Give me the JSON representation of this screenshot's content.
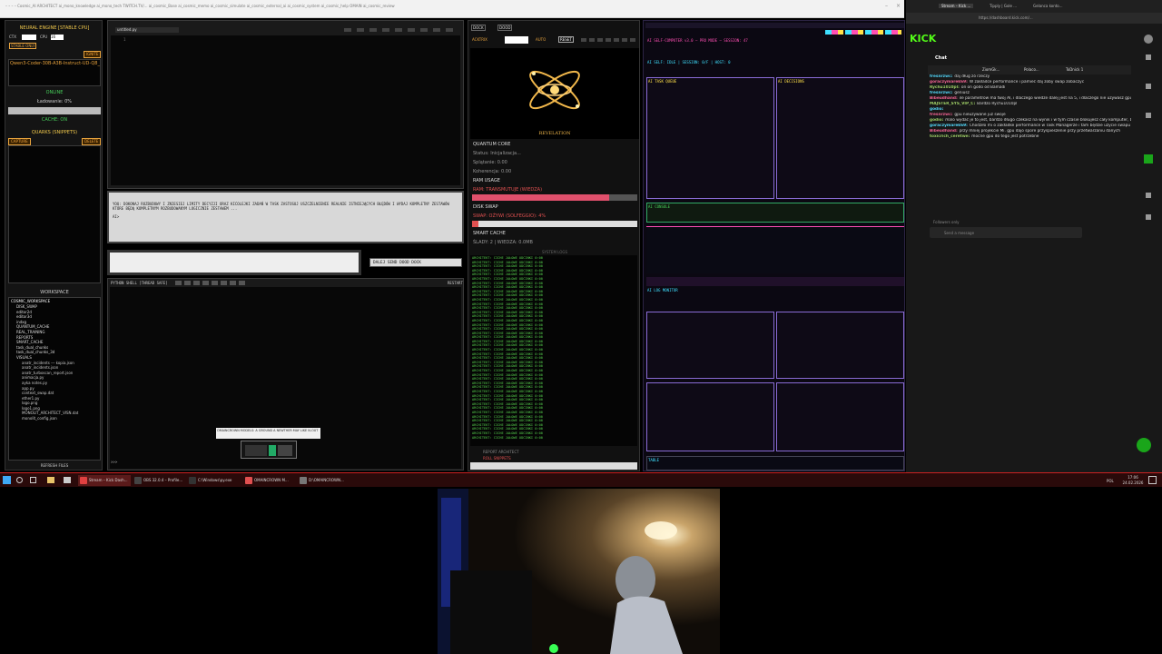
{
  "top_strip": {
    "tabs_text": "– – – – Cosmic_AI ARCHITECT   ai_mono_knowledge   ai_mono_tech   TWITCH.TV/...   ai_cosmic_Base   ai_cosmic_memo   ai_cosmic_simulate   ai_cosmic_external_ai   ai_cosmic_system   ai_cosmic_help   OMAIN   ai_cosmic_review"
  },
  "left_panel": {
    "title": "NEURAL ENGINE [STABLE CPU]",
    "ctx_label": "CTX",
    "cpu_label": "CPU",
    "cpu_value": "16",
    "stable_badge": "STABLE ONLY",
    "ignite_button": "IGNITE",
    "model_name": "Qwen3-Coder-30B-A3B-Instruct-UD-Q8_K_XL",
    "status_online": "ONLINE",
    "loading_text": "Ładowanie: 0%",
    "cache_status": "CACHE: ON",
    "quarks_title": "QUARKS (SNIPPETS)",
    "capture_button": "CAPTURE",
    "delete_button": "DELETE",
    "workspace_title": "WORKSPACE",
    "tree_root": "COSMIC_WORKSPACE",
    "tree_items": [
      "DISK_SWAP",
      "editor2d",
      "editor3d",
      "indxg",
      "QUANTUM_CACHE",
      "REAL_TRAINING",
      "REPORTS",
      "SMART_CACHE",
      "task_dual_chunks",
      "task_dual_chunks_3d",
      "VISUALS"
    ],
    "file_items": [
      "anatr_incidents --- kopia.json",
      "anatr_incidents.json",
      "anatr_turboscan_report.json",
      "animacja.py",
      "ayka notes.py",
      "app.py",
      "context_swap.dat",
      "ether1.py",
      "logo.png",
      "logo1.png",
      "MONOLIT_ARCHITECT_VISN.dat",
      "monolit_config.json"
    ],
    "refresh_button": "REFRESH FILES"
  },
  "editor": {
    "tab_name": "untitled.py",
    "line_number": "1",
    "prompt_text": "YOU: DOKONAJ ROZBUDOWY I ZNIESIEJ LIMITY DECYZJI ORAZ KICOLEJKI ZADAŃ W TASK ZASTOSUJ USZCZELNIENIE REALNIE ISTNIEJĄCYCH BŁĘDÓW I WYDAJ KOMPLETNY ZESTAWÓW KTÓRE BĘDĄ KOMPLETNYM ROZBUDOWANYM LOGICZNIE ZESTAWEM ...",
    "prompt_line2": "AI>",
    "send_button": "DALEJ SEND DOOD DOCK"
  },
  "shell": {
    "title": "PYTHON SHELL [THREAD SAFE]",
    "restart_button": "RESTART",
    "prompt": ">>>",
    "popup_text": "OMAINCROWN MODELS: A GROUND A NEWTHER MAY LIKE N-OUT"
  },
  "quantum": {
    "tabs": [
      "DOCK",
      "DOOD"
    ],
    "active_label": "ACKTRIX",
    "auto_label": "AUTO",
    "reset_button": "RESET",
    "revelation_label": "REVELATION",
    "quantum_core_title": "QUANTUM CORE",
    "status_text": "Status: Inicjalizacja...",
    "splatanie": "Splątanie: 0.00",
    "koherencja": "Koherencja: 0.00",
    "ram_title": "RAM USAGE",
    "ram_status": "RAM: TRANSMUTUJE (WIEDZA)",
    "ram_fill": 0.83,
    "disk_title": "DISK SWAP",
    "disk_status": "SWAP: OŻYWI (SOLFEGGIO): 4%",
    "disk_fill": 0.04,
    "smart_cache_title": "SMART CACHE",
    "smart_cache_status": "ŚLADY: 2 | WIEDZA: 0.0MB",
    "system_logs_title": "SYSTEM LOGS",
    "log_entry": "ARCHITEKT: CICHE JAŁOWE ODCINKI 0:00",
    "report_label": "REPORT ARCHITECT",
    "snippets_label": "ROLL SNIPPETS"
  },
  "ai_panel": {
    "title": "AI SELF-COMPUTER v3.0 – PRO MODE – SESSION: 47",
    "subtitle": "AI SELF: IDLE | SESSION: 0/F | HOST: 0",
    "left_box_title": "AI TASK QUEUE",
    "right_box_title": "AI DECISIONS",
    "console_title": "AI CONSOLE",
    "chart_title": "AI LOG MONITOR",
    "footer_label": "TABLE"
  },
  "stream": {
    "brand": "KICK",
    "chat_title": "Chat",
    "tabs": [
      "Stream – Kick ...",
      "Tipply | Gole ...",
      "Gelanca konto..."
    ],
    "url": "https://dashboard.kick.com/...",
    "header_users": [
      "ZiomGk...",
      "Polaco...",
      "ToDnick 1"
    ],
    "messages": [
      {
        "user": "fresnrzwc:",
        "text": "daj dług zó rzeczy"
      },
      {
        "user": "goraczymarek69:",
        "text": "W zakładce performance i pamieć daj zoby swap zobaczyc"
      },
      {
        "user": "Rychu1010pl:",
        "text": "on on godo od Bamadi"
      },
      {
        "user": "fresnrzwc:",
        "text": "geniusz"
      },
      {
        "user": "Bibeudhand:",
        "text": "ile parametrow ma twoj AI, i dlaczego wiedze dalej jest na 5, i dlaczego nie uzywasz gpu?"
      },
      {
        "user": "MAJSTER_SYS_VIP_C:",
        "text": "Bardzo Rychu1010pl"
      },
      {
        "user": "godio:",
        "text": ""
      },
      {
        "user": "fresnrzwc:",
        "text": "gpu nieuzywane już swoje"
      },
      {
        "user": "godio:",
        "text": "malo wydać je to jest, bardzo długo czekasz na wynik i w tym czasie blokujesz cały komputer, bo nie użyć procesor 100%, pod to kup sobie jakiś serwer może z mocnym CPU"
      },
      {
        "user": "goraczymarek69:",
        "text": "Chodziło mi o zakładke performance w Task Managerze i tam będzie użycie swapu i wszystko"
      },
      {
        "user": "Bibeudhand:",
        "text": "przy mniej projekcie Mi. gpu dajo spore przyspieszenie przy przetwarzaniu danych"
      },
      {
        "user": "toxicrich_ceretwe:",
        "text": "mocne gpu do tego jest potrzebne"
      }
    ],
    "followers_only": "Followers only",
    "chat_placeholder": "Send a message",
    "chat_button": "Chat"
  },
  "taskbar": {
    "items": [
      "Stream – Kick Dash...",
      "OBS 32.0.4 – Profile...",
      "C:\\Windows\\py.exe",
      "OMAINCROWN M...",
      "D:\\OMAINCROWN..."
    ],
    "lang": "POL",
    "time": "17:06",
    "date": "24.02.2026"
  },
  "colors": {
    "accent_orange": "#e8a33d",
    "accent_green": "#47d05a",
    "kick_green": "#53fc18",
    "taskbar_red": "#c22222",
    "purple": "#8a6cd6"
  }
}
